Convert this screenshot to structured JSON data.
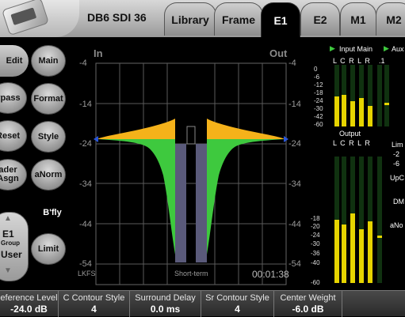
{
  "header": {
    "device_title": "DB6 SDI 36",
    "tabs": [
      "Library",
      "Frame",
      "E1",
      "E2",
      "M1",
      "M2"
    ],
    "active_tab": "E1"
  },
  "sidebar": {
    "edit": "Edit",
    "buttons_left": [
      "ypass",
      "Reset",
      "ader\nAsgn"
    ],
    "buttons_right": [
      "Main",
      "Format",
      "Style",
      "aNorm",
      "B'fly",
      "Limit"
    ],
    "group": {
      "top": "E1",
      "mid": "Group",
      "bottom": "User"
    }
  },
  "meter": {
    "in_label": "In",
    "out_label": "Out",
    "scale": [
      "-4",
      "-14",
      "-24",
      "-34",
      "-44",
      "-54"
    ],
    "unit": "LKFS",
    "mode": "Short-term",
    "time": "00:01:38",
    "colors": {
      "loud": "#f5b21a",
      "soft": "#3ec93e",
      "bar": "#5a5a7a",
      "marker": "#2a56d8"
    }
  },
  "right_panel": {
    "input_main": "Input Main",
    "aux": "Aux",
    "ch_labels_in": "L C R L R",
    "ch_labels_aux": ".1",
    "output": "Output",
    "ch_labels_out": "L C R L R",
    "scale_top": [
      "0",
      "-6",
      "-12",
      "-18",
      "-24",
      "-30",
      "-42",
      "-60"
    ],
    "scale_bot": [
      "-18",
      "-20",
      "-24",
      "-30",
      "-36",
      "-40",
      "-60"
    ],
    "side_labels": [
      "Lim",
      "-2",
      "-6",
      "UpC",
      "DM",
      "aNo"
    ],
    "bar_color": "#e6d400"
  },
  "bottom_params": [
    {
      "label": "eference Level",
      "value": "-24.0 dB"
    },
    {
      "label": "C Contour Style",
      "value": "4"
    },
    {
      "label": "Surround Delay",
      "value": "0.0 ms"
    },
    {
      "label": "Sr Contour Style",
      "value": "4"
    },
    {
      "label": "Center Weight",
      "value": "-6.0 dB"
    }
  ]
}
